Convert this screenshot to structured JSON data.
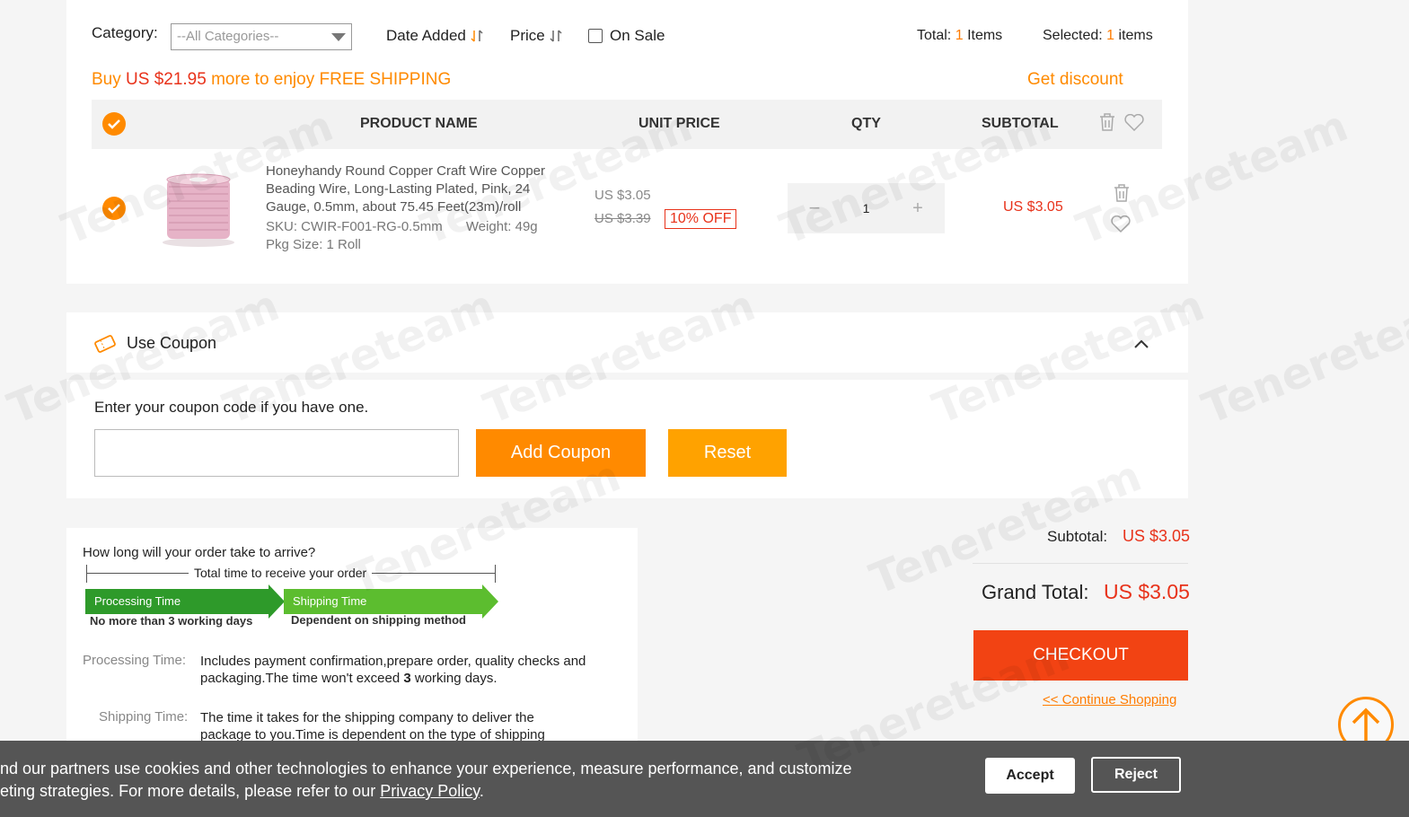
{
  "filters": {
    "category_label": "Category:",
    "category_value": "--All Categories--",
    "date_added": "Date Added",
    "price": "Price",
    "on_sale": "On Sale",
    "total_label": "Total:",
    "total_count": "1",
    "total_unit": "Items",
    "selected_label": "Selected:",
    "selected_count": "1",
    "selected_unit": "items"
  },
  "shipping_banner": {
    "prefix": "Buy",
    "amount": "US $21.95",
    "suffix": "more to enjoy FREE SHIPPING",
    "get_discount": "Get discount"
  },
  "table": {
    "headers": [
      "PRODUCT NAME",
      "UNIT PRICE",
      "QTY",
      "SUBTOTAL"
    ]
  },
  "product": {
    "name": "Honeyhandy Round Copper Craft Wire Copper Beading Wire, Long-Lasting Plated, Pink, 24 Gauge, 0.5mm, about 75.45 Feet(23m)/roll",
    "sku": "SKU: CWIR-F001-RG-0.5mm",
    "weight": "Weight: 49g",
    "pkg_size": "Pkg Size: 1 Roll",
    "price": "US $3.05",
    "original_price": "US $3.39",
    "discount": "10% OFF",
    "qty": "1",
    "subtotal": "US $3.05"
  },
  "coupon": {
    "title": "Use Coupon",
    "prompt": "Enter your coupon code if you have one.",
    "input_value": "",
    "add_button": "Add Coupon",
    "reset_button": "Reset"
  },
  "delivery": {
    "question": "How long will your order take to arrive?",
    "total_time": "Total time to receive your order",
    "processing_step": "Processing Time",
    "processing_sub": "No more than 3 working days",
    "shipping_step": "Shipping Time",
    "shipping_sub": "Dependent on shipping method",
    "processing_label": "Processing Time:",
    "processing_desc_1": "Includes payment confirmation,prepare order, quality checks and packaging.The time won't exceed",
    "processing_days": "3",
    "processing_desc_2": "working days.",
    "shipping_label": "Shipping Time:",
    "shipping_desc": "The time it takes for the shipping company to deliver the package to you.Time is dependent on the type of shipping method selected."
  },
  "summary": {
    "subtotal_label": "Subtotal:",
    "subtotal_value": "US $3.05",
    "grand_total_label": "Grand Total:",
    "grand_total_value": "US $3.05",
    "checkout": "CHECKOUT",
    "continue_shopping": "<< Continue Shopping"
  },
  "cookie": {
    "text_1": "nd our partners use cookies and other technologies to enhance your experience, measure performance, and customize",
    "text_2": "eting strategies. For more details, please refer to our",
    "policy_link": "Privacy Policy",
    "text_end": ".",
    "accept": "Accept",
    "reject": "Reject"
  },
  "watermark": "Tenereteam",
  "colors": {
    "accent_orange": "#ff8a00",
    "price_red": "#e8321a",
    "checkout": "#f24313",
    "cookie_bar": "#555555"
  }
}
